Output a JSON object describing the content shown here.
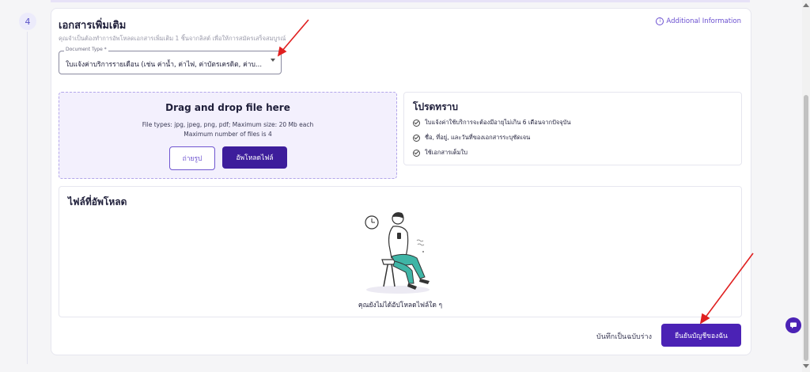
{
  "step": {
    "number": "4"
  },
  "section": {
    "title": "เอกสารเพิ่มเติม",
    "subtitle": "คุณจำเป็นต้องทำการอัพโหลดเอกสารเพิ่มเติม 1 ชิ้นจากลิสต์ เพื่อให้การสมัครเสร็จสมบูรณ์",
    "additional_info": "Additional Information"
  },
  "document_type": {
    "label": "Document Type *",
    "value": "ใบแจ้งค่าบริการรายเดือน (เช่น ค่าน้ำ, ค่าไฟ, ค่าบัตรเครดิต, ค่าบ..."
  },
  "dropzone": {
    "title": "Drag and drop file here",
    "file_types": "File types: jpg, jpeg, png, pdf; Maximum size: 20 Mb each",
    "max_files": "Maximum number of files is 4",
    "photo_button": "ถ่ายรูป",
    "upload_button": "อัพโหลดไฟล์"
  },
  "notice": {
    "title": "โปรดทราบ",
    "items": [
      "ใบแจ้งค่าใช้บริการจะต้องมีอายุไม่เกิน 6 เดือนจากปัจจุบัน",
      "ชื่อ, ที่อยู่, และวันที่ของเอกสารระบุชัดเจน",
      "ใช้เอกสารเต็มใบ"
    ]
  },
  "uploaded_files": {
    "title": "ไฟล์ที่อัพโหลด",
    "empty_message": "คุณยังไม่ได้อัปโหลดไฟล์ใด ๆ"
  },
  "footer": {
    "save_draft": "บันทึกเป็นฉบับร่าง",
    "confirm": "ยืนยันบัญชีของฉัน"
  },
  "colors": {
    "accent": "#4b22b5",
    "accent_light": "#f3f0fd",
    "annotation_arrow": "#e02020"
  }
}
